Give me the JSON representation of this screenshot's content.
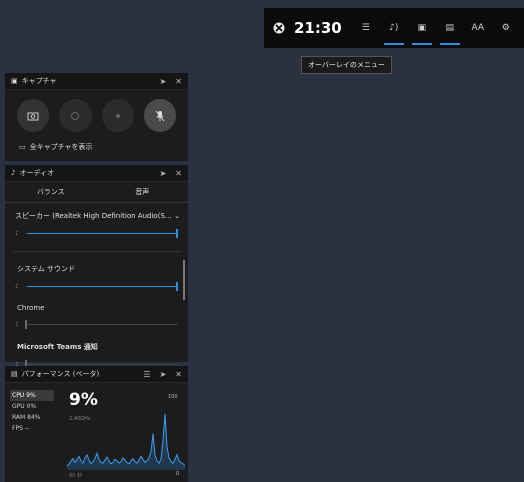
{
  "top_bar": {
    "time": "21:30",
    "tooltip": "オーバーレイのメニュー",
    "icons": [
      "xbox-logo-icon",
      "widget-menu-icon",
      "audio-icon",
      "capture-icon",
      "performance-icon",
      "text-size-icon",
      "settings-icon"
    ]
  },
  "capture": {
    "title": "キャプチャ",
    "show_all": "全キャプチャを表示"
  },
  "audio": {
    "title": "オーディオ",
    "tabs": [
      "バランス",
      "音声"
    ],
    "device": "スピーカー (Realtek High Definition Audio(S...",
    "device_volume": 1.0,
    "apps": [
      {
        "name": "システム サウンド",
        "volume": 1.0
      },
      {
        "name": "Chrome",
        "volume": 0.0
      },
      {
        "name": "Microsoft Teams 通知",
        "volume": 0.0
      }
    ]
  },
  "performance": {
    "title": "パフォーマンス (ベータ)",
    "stats": [
      {
        "label": "CPU",
        "value": "9%"
      },
      {
        "label": "GPU",
        "value": "0%"
      },
      {
        "label": "RAM",
        "value": "84%"
      },
      {
        "label": "FPS",
        "value": "--"
      }
    ],
    "big_value": "9%",
    "freq": "2.40GHz",
    "y_max": "100",
    "y_min": "0",
    "x_label": "60 秒"
  },
  "chart_data": {
    "type": "line",
    "title": "",
    "xlabel": "60 秒",
    "ylabel": "",
    "ylim": [
      0,
      100
    ],
    "series": [
      {
        "values": [
          5,
          8,
          12,
          15,
          10,
          14,
          18,
          12,
          9,
          16,
          20,
          13,
          8,
          11,
          15,
          22,
          14,
          10,
          9,
          13,
          17,
          12,
          8,
          10,
          14,
          12,
          9,
          11,
          16,
          13,
          10,
          8,
          12,
          15,
          11,
          9,
          13,
          18,
          14,
          10,
          12,
          16,
          24,
          48,
          20,
          12,
          9,
          14,
          38,
          74,
          30,
          16,
          11,
          9,
          14,
          20,
          12,
          10,
          8,
          6
        ]
      }
    ]
  }
}
